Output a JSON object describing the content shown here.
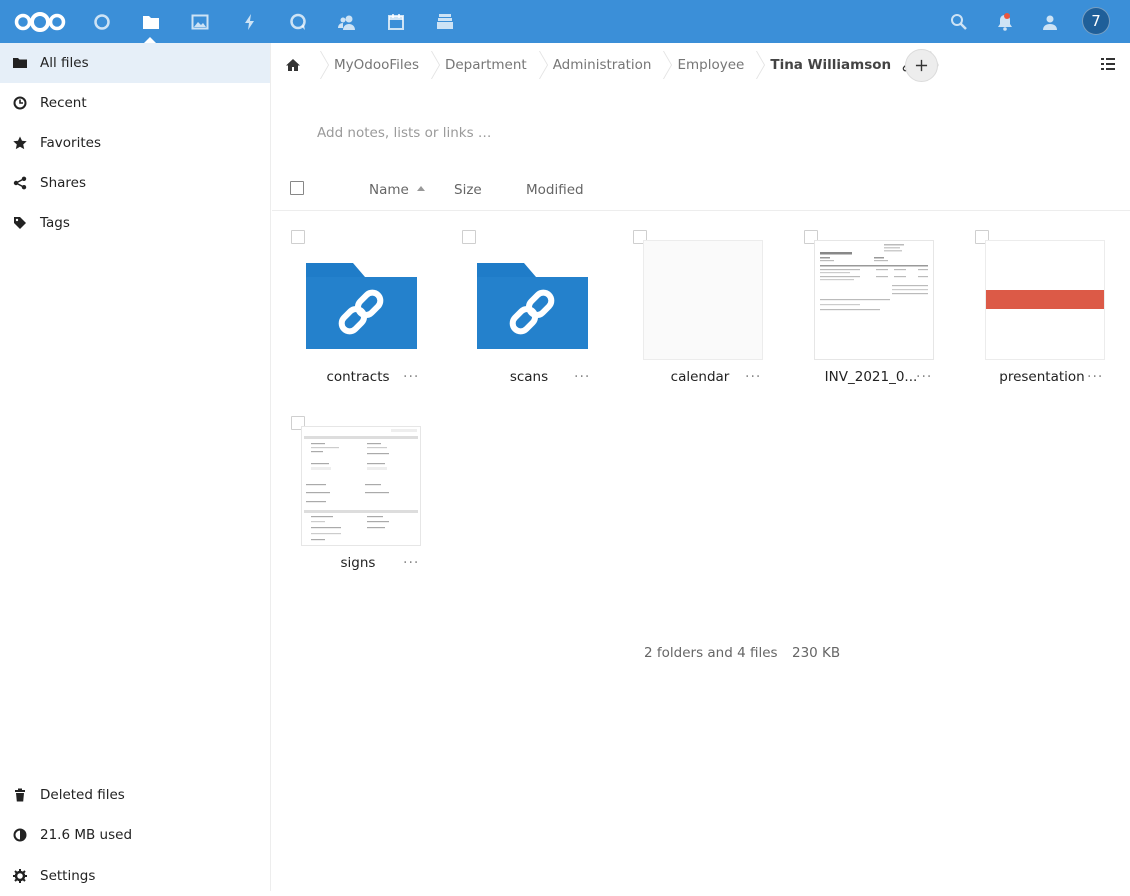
{
  "header": {
    "apps": [
      {
        "name": "dashboard-icon"
      },
      {
        "name": "files-icon"
      },
      {
        "name": "photos-icon"
      },
      {
        "name": "activity-icon"
      },
      {
        "name": "talk-icon"
      },
      {
        "name": "contacts-icon"
      },
      {
        "name": "calendar-icon"
      },
      {
        "name": "deck-icon"
      }
    ],
    "avatar_initial": "7",
    "brand_color": "#3b8fd8"
  },
  "sidebar": {
    "items": [
      {
        "label": "All files",
        "icon": "folder-icon"
      },
      {
        "label": "Recent",
        "icon": "clock-icon"
      },
      {
        "label": "Favorites",
        "icon": "star-icon"
      },
      {
        "label": "Shares",
        "icon": "share-icon"
      },
      {
        "label": "Tags",
        "icon": "tag-icon"
      }
    ],
    "bottom": [
      {
        "label": "Deleted files",
        "icon": "trash-icon"
      },
      {
        "label": "21.6 MB used",
        "icon": "quota-icon"
      },
      {
        "label": "Settings",
        "icon": "gear-icon"
      }
    ]
  },
  "breadcrumb": {
    "items": [
      "MyOdooFiles",
      "Department",
      "Administration",
      "Employee",
      "Tina Williamson"
    ]
  },
  "notes": {
    "placeholder": "Add notes, lists or links …"
  },
  "table": {
    "columns": {
      "name": "Name",
      "size": "Size",
      "modified": "Modified"
    }
  },
  "files": [
    {
      "name": "contracts",
      "type": "shared-folder"
    },
    {
      "name": "scans",
      "type": "shared-folder"
    },
    {
      "name": "calendar",
      "type": "file"
    },
    {
      "name": "INV_2021_0...",
      "type": "pdf"
    },
    {
      "name": "presentation",
      "type": "presentation"
    },
    {
      "name": "signs",
      "type": "document"
    }
  ],
  "summary": {
    "counts": "2 folders and 4 files",
    "size": "230 KB"
  }
}
